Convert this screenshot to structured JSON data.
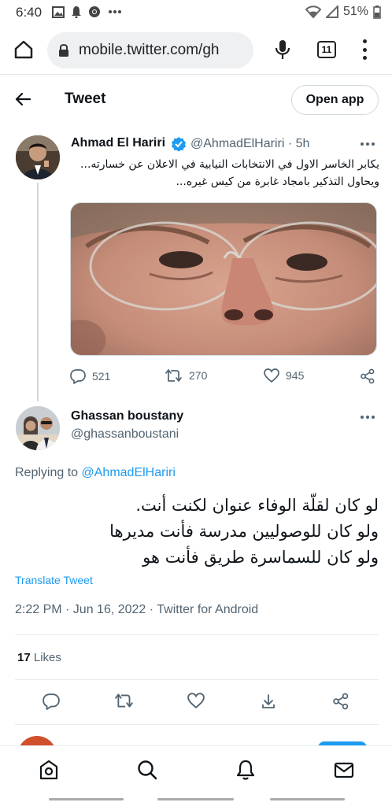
{
  "status_bar": {
    "time": "6:40",
    "battery": "51%",
    "left_icons": [
      "image-icon",
      "bell-icon",
      "chrome-icon",
      "more-icon"
    ],
    "right_icons": [
      "wifi-icon",
      "signal-icon",
      "battery-icon"
    ]
  },
  "browser": {
    "url": "mobile.twitter.com/gh",
    "tab_count": "11",
    "icons": [
      "home-icon",
      "lock-icon",
      "mic-icon",
      "tabs-icon",
      "menu-icon"
    ]
  },
  "header": {
    "title": "Tweet",
    "open_app_label": "Open app"
  },
  "tweet": {
    "author_name": "Ahmad El Hariri",
    "author_handle": "@AhmadElHariri · 5h",
    "text": "يكابر الخاسر الاول في الانتخابات النيابية في الاعلان عن خسارته... ويحاول التذكير بامجاد غابرة من كيس غيره...",
    "stats": {
      "replies": "521",
      "retweets": "270",
      "likes": "945"
    }
  },
  "reply": {
    "author_name": "Ghassan boustany",
    "author_handle": "@ghassanboustani",
    "replying_prefix": "Replying to",
    "replying_to": "@AhmadElHariri",
    "text": "لو كان لقلّة الوفاء عنوان لكنت أنت.\nولو كان للوصوليين مدرسة فأنت مديرها\nولو كان للسماسرة طريق فأنت هو",
    "translate_label": "Translate Tweet",
    "meta": "2:22 PM · Jun 16, 2022 · Twitter for Android",
    "likes_count": "17",
    "likes_label": " Likes"
  },
  "colors": {
    "accent": "#1d9bf0",
    "muted": "#536471",
    "text": "#0f1419"
  }
}
